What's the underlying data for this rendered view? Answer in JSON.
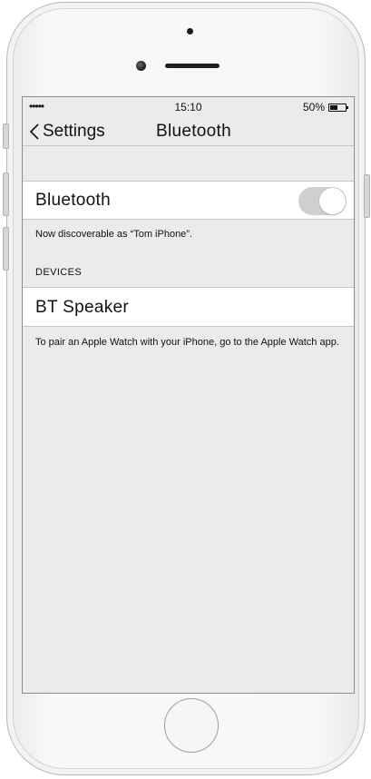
{
  "status_bar": {
    "signal": "•••••",
    "time": "15:10",
    "battery_percent": "50%",
    "battery_level": 0.5
  },
  "nav": {
    "back_label": "Settings",
    "back_icon": "chevron-left-icon",
    "title": "Bluetooth"
  },
  "bluetooth_cell": {
    "label": "Bluetooth",
    "toggle_on": true
  },
  "discoverable_text": "Now discoverable as “Tom iPhone”.",
  "devices": {
    "header": "DEVICES",
    "items": [
      {
        "name": "BT Speaker"
      }
    ]
  },
  "pair_note": "To pair an Apple Watch with your iPhone, go to the Apple Watch app."
}
